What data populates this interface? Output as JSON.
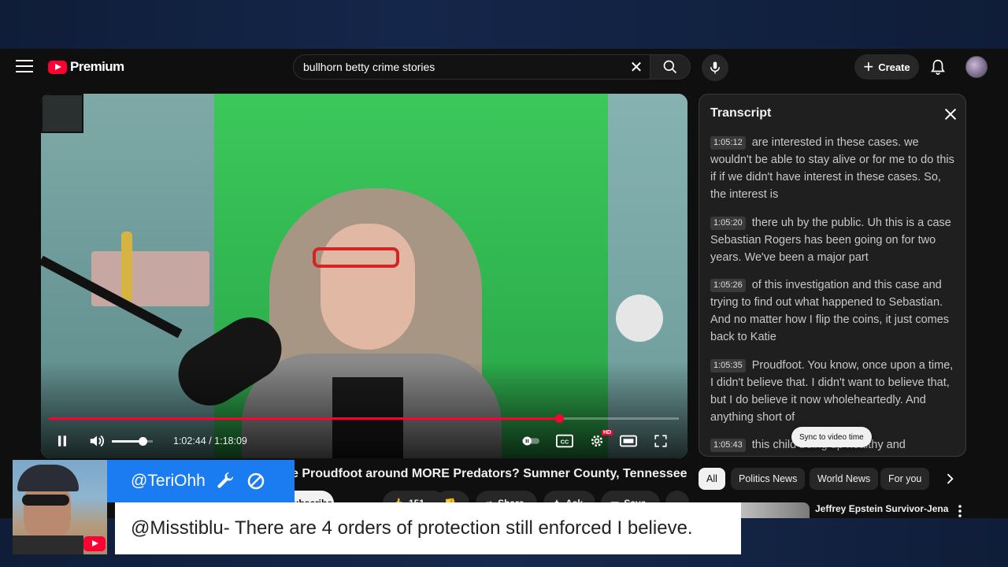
{
  "header": {
    "logo_text": "Premium",
    "search": {
      "value": "bullhorn betty crime stories",
      "placeholder": "Search"
    },
    "create_label": "Create"
  },
  "player": {
    "progress_fraction": 0.81,
    "volume_fraction": 0.75,
    "time_current": "1:02:44",
    "time_separator": " / ",
    "time_total": "1:18:09",
    "is_playing": true
  },
  "video": {
    "title": "e Proudfoot around MORE Predators? Sumner County, Tennessee",
    "subscribe_label": "Subscribe",
    "like_count": "151",
    "share_label": "Share",
    "ask_label": "Ask",
    "save_label": "Save"
  },
  "transcript": {
    "title": "Transcript",
    "segments": [
      {
        "time": "1:05:12",
        "text": "are interested in these cases. we wouldn't be able to stay alive or for me to do this if if we didn't have interest in these cases. So, the interest is"
      },
      {
        "time": "1:05:20",
        "text": "there uh by the public. Uh this is a case Sebastian Rogers has been going on for two years. We've been a major part"
      },
      {
        "time": "1:05:26",
        "text": "of this investigation and this case and trying to find out what happened to Sebastian. And no matter how I flip the coins, it just comes back to Katie"
      },
      {
        "time": "1:05:35",
        "text": "Proudfoot. You know, once upon a time, I didn't believe that. I didn't want to believe that, but I do believe it now wholeheartedly. And anything short of"
      },
      {
        "time": "1:05:43",
        "text": "this child being up healthy and"
      }
    ],
    "sync_label": "Sync to video time"
  },
  "chips": [
    "All",
    "Politics News",
    "World News",
    "For you"
  ],
  "recommendation": {
    "title": "Jeffrey Epstein Survivor-Jena"
  },
  "overlay": {
    "username": "@TeriOhh",
    "comment": "@Misstiblu- There are 4 orders of protection still enforced I believe."
  },
  "colors": {
    "accent": "#ff0033",
    "name_tag": "#1a7cf0",
    "background": "#0f0f0f",
    "frame": "#14264a"
  },
  "icons": {
    "menu": "menu-icon",
    "search": "search-icon",
    "mic": "mic-icon",
    "bell": "bell-icon",
    "pause": "pause-icon",
    "volume": "volume-icon",
    "cc": "cc-icon",
    "settings": "gear-icon",
    "fullscreen": "fullscreen-icon",
    "close": "close-icon",
    "wrench": "wrench-icon",
    "blocked": "block-icon",
    "youtube": "youtube-icon"
  }
}
